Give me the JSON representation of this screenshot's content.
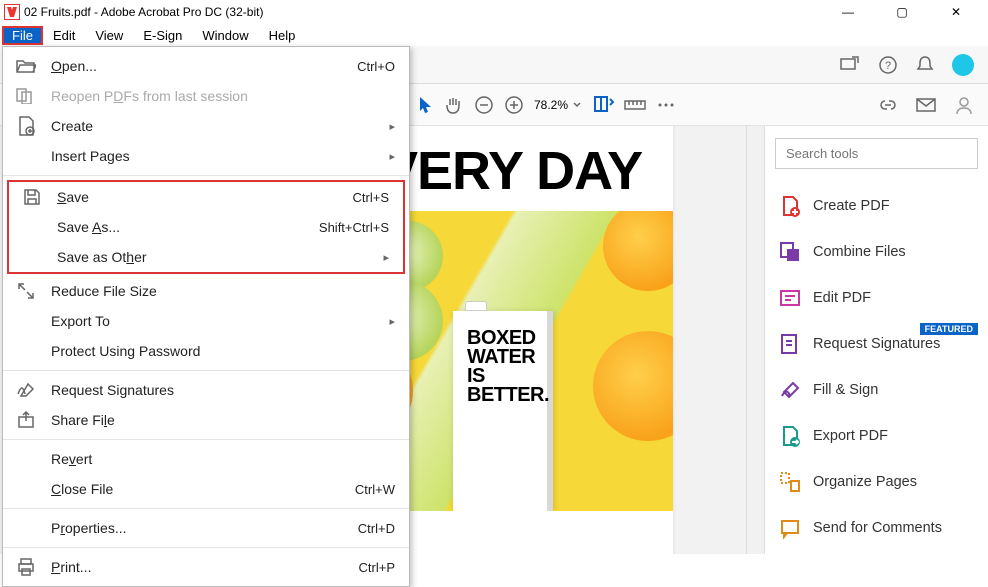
{
  "window": {
    "title": "02 Fruits.pdf - Adobe Acrobat Pro DC (32-bit)"
  },
  "menubar": {
    "file": "File",
    "edit": "Edit",
    "view": "View",
    "esign": "E-Sign",
    "window": "Window",
    "help": "Help"
  },
  "toolbar": {
    "zoom": "78.2%"
  },
  "document": {
    "heading": "EVERY DAY",
    "carton": "BOXED\nWATER\nIS\nBETTER."
  },
  "sidebar": {
    "search_placeholder": "Search tools",
    "tools": [
      {
        "label": "Create PDF"
      },
      {
        "label": "Combine Files"
      },
      {
        "label": "Edit PDF"
      },
      {
        "label": "Request Signatures",
        "badge": "FEATURED"
      },
      {
        "label": "Fill & Sign"
      },
      {
        "label": "Export PDF"
      },
      {
        "label": "Organize Pages"
      },
      {
        "label": "Send for Comments"
      }
    ]
  },
  "file_menu": {
    "open": {
      "label": "Open...",
      "shortcut": "Ctrl+O",
      "underline": "O"
    },
    "reopen": {
      "label": "Reopen PDFs from last session",
      "underline": "D"
    },
    "create": {
      "label": "Create",
      "underline": ""
    },
    "insert": {
      "label": "Insert Pages",
      "underline": ""
    },
    "save": {
      "label": "Save",
      "shortcut": "Ctrl+S",
      "underline": "S"
    },
    "saveas": {
      "label": "Save As...",
      "shortcut": "Shift+Ctrl+S",
      "underline": "A"
    },
    "saveother": {
      "label": "Save as Other",
      "underline": "h"
    },
    "reduce": {
      "label": "Reduce File Size",
      "underline": ""
    },
    "export": {
      "label": "Export To",
      "underline": ""
    },
    "protect": {
      "label": "Protect Using Password",
      "underline": ""
    },
    "reqsig": {
      "label": "Request Signatures",
      "underline": ""
    },
    "share": {
      "label": "Share File",
      "underline": "l"
    },
    "revert": {
      "label": "Revert",
      "underline": "v"
    },
    "close": {
      "label": "Close File",
      "shortcut": "Ctrl+W",
      "underline": "C"
    },
    "properties": {
      "label": "Properties...",
      "shortcut": "Ctrl+D",
      "underline": "r"
    },
    "print": {
      "label": "Print...",
      "shortcut": "Ctrl+P",
      "underline": "P"
    }
  }
}
